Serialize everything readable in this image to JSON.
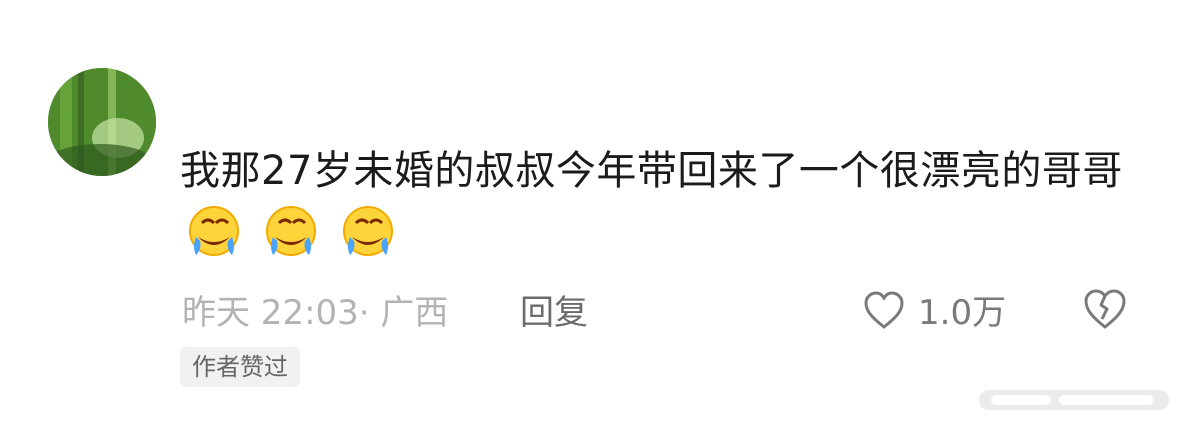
{
  "comment": {
    "text": "我那27岁未婚的叔叔今年带回来了一个很漂亮的哥哥",
    "emoji_icons": [
      "rofl-emoji-icon",
      "rofl-emoji-icon",
      "rofl-emoji-icon"
    ]
  },
  "meta": {
    "time_location": "昨天 22:03· 广西",
    "reply_label": "回复",
    "like_count": "1.0万"
  },
  "badge": {
    "label": "作者赞过"
  },
  "icons": {
    "avatar": "avatar-image",
    "like": "heart-outline-icon",
    "dislike": "broken-heart-icon",
    "watermark": "watermark-logo"
  },
  "colors": {
    "text": "#1b1b1b",
    "meta": "#b3b3b3",
    "reply": "#6b6b6b",
    "badge_bg": "#f1f1f1"
  }
}
